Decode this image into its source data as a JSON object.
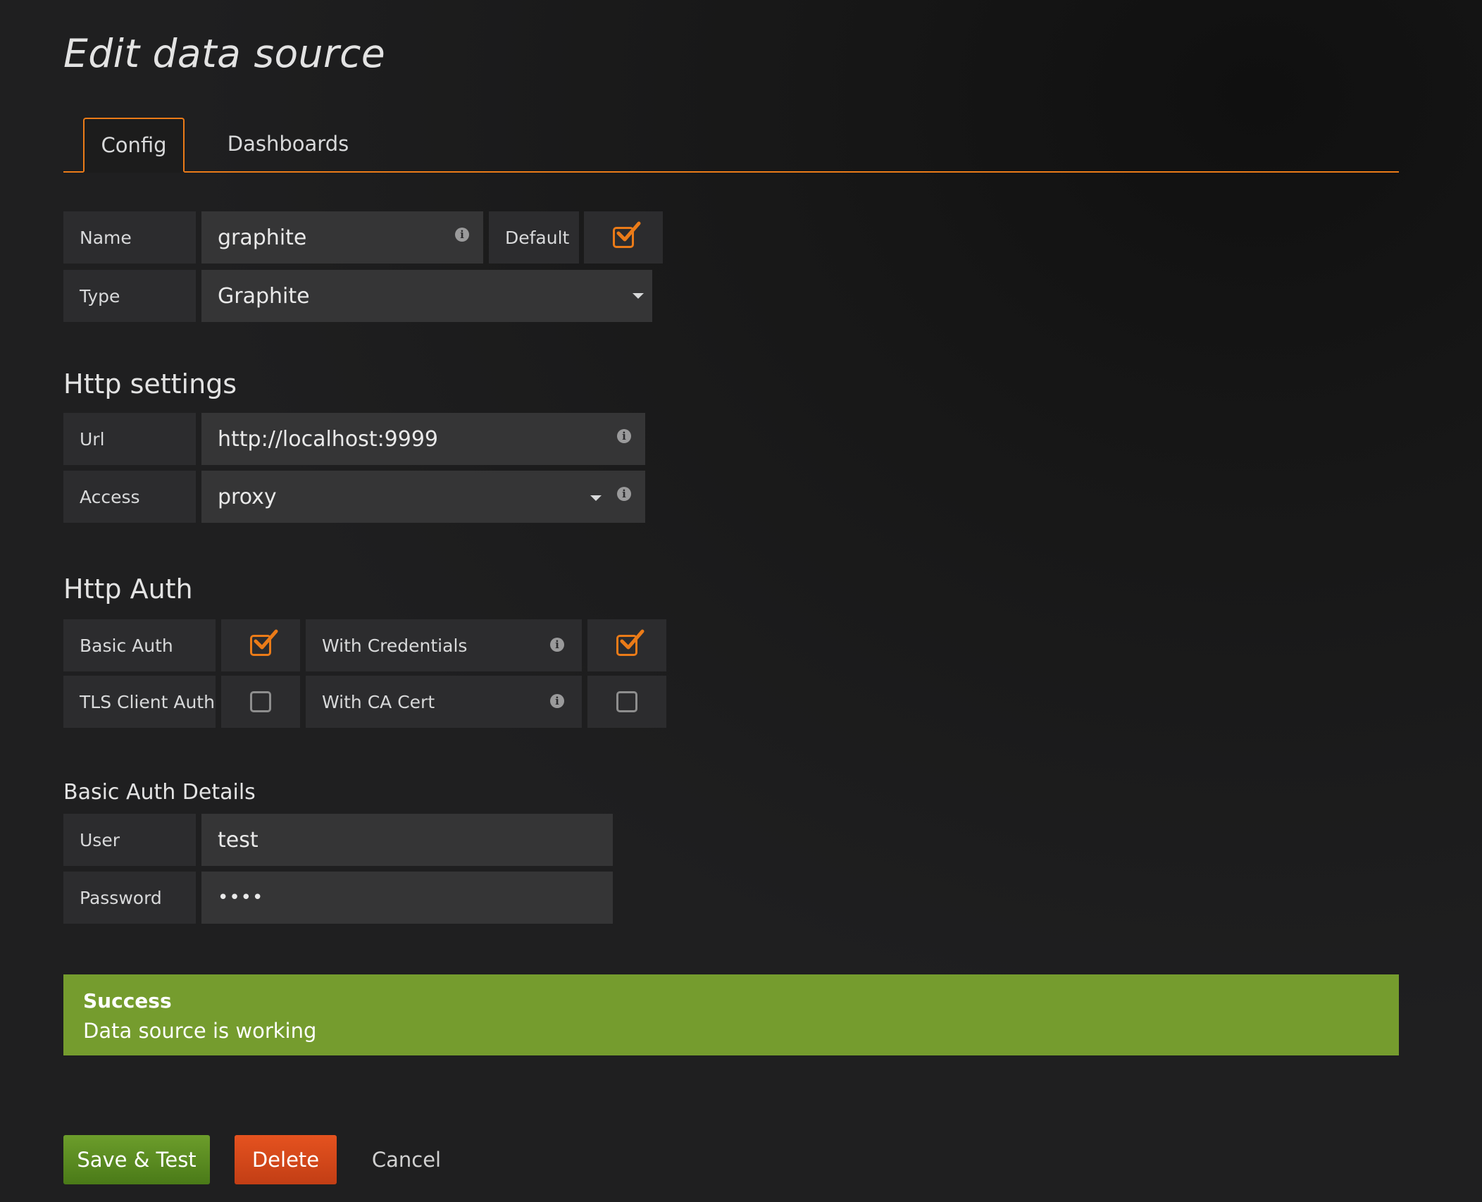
{
  "page_title": "Edit data source",
  "tabs": [
    {
      "label": "Config",
      "active": true
    },
    {
      "label": "Dashboards",
      "active": false
    }
  ],
  "general": {
    "name_label": "Name",
    "name_value": "graphite",
    "default_label": "Default",
    "default_checked": true,
    "type_label": "Type",
    "type_value": "Graphite"
  },
  "http_settings": {
    "heading": "Http settings",
    "url_label": "Url",
    "url_value": "http://localhost:9999",
    "access_label": "Access",
    "access_value": "proxy"
  },
  "http_auth": {
    "heading": "Http Auth",
    "basic_auth_label": "Basic Auth",
    "basic_auth_checked": true,
    "with_credentials_label": "With Credentials",
    "with_credentials_checked": true,
    "tls_client_auth_label": "TLS Client Auth",
    "tls_client_auth_checked": false,
    "with_ca_cert_label": "With CA Cert",
    "with_ca_cert_checked": false
  },
  "basic_auth_details": {
    "heading": "Basic Auth Details",
    "user_label": "User",
    "user_value": "test",
    "password_label": "Password",
    "password_value": "••••"
  },
  "alert": {
    "title": "Success",
    "message": "Data source is working",
    "color": "#759c2e"
  },
  "buttons": {
    "save_label": "Save & Test",
    "delete_label": "Delete",
    "cancel_label": "Cancel"
  },
  "colors": {
    "accent": "#eb7b18",
    "save": "#5b8c22",
    "delete": "#d44a1a"
  },
  "icons": {
    "info": "info-circle",
    "caret": "caret-down",
    "check": "checkmark"
  }
}
